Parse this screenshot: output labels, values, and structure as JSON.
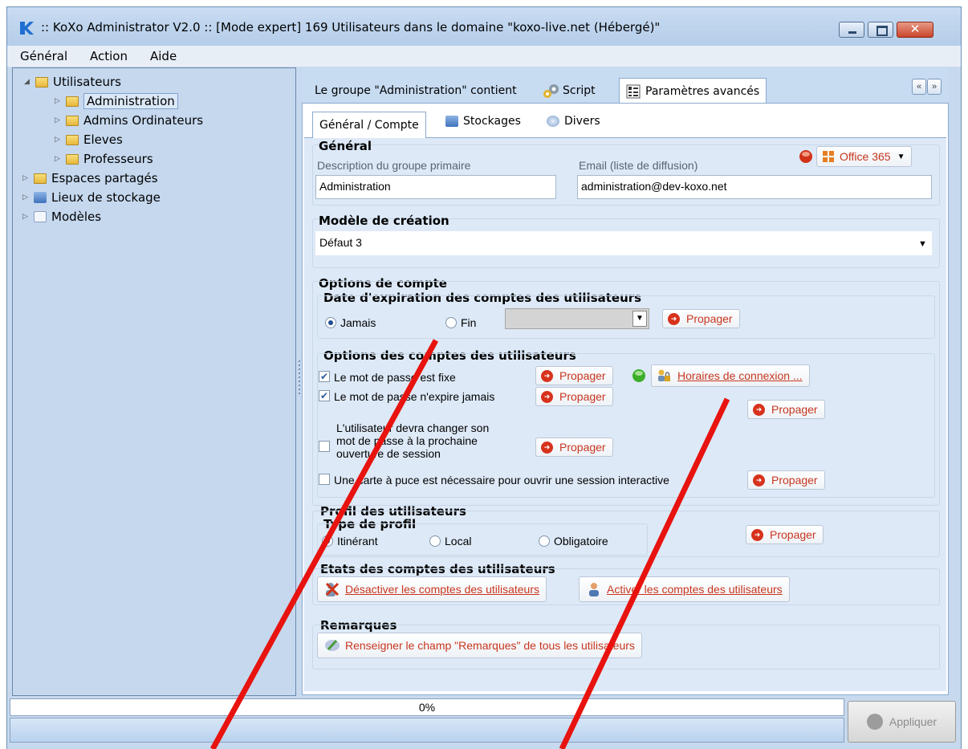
{
  "window": {
    "title": ":: KoXo Administrator V2.0 :: [Mode expert] 169 Utilisateurs dans le domaine \"koxo-live.net (Hébergé)\"",
    "close_glyph": "✕"
  },
  "menu": {
    "items": [
      "Général",
      "Action",
      "Aide"
    ]
  },
  "tree": {
    "items": [
      {
        "label": "Utilisateurs",
        "icon": "folder-icon"
      },
      {
        "label": "Administration",
        "icon": "folder-icon"
      },
      {
        "label": "Admins Ordinateurs",
        "icon": "folder-icon"
      },
      {
        "label": "Eleves",
        "icon": "folder-icon"
      },
      {
        "label": "Professeurs",
        "icon": "folder-icon"
      },
      {
        "label": "Espaces partagés",
        "icon": "shared-folder-icon"
      },
      {
        "label": "Lieux de stockage",
        "icon": "storage-icon"
      },
      {
        "label": "Modèles",
        "icon": "template-icon"
      }
    ]
  },
  "top_tabs": {
    "contains_label": "Le groupe \"Administration\" contient",
    "script": "Script",
    "advanced": "Paramètres avancés",
    "nav_prev": "«",
    "nav_next": "»"
  },
  "sub_tabs": {
    "general": "Général / Compte",
    "storage": "Stockages",
    "misc": "Divers"
  },
  "general": {
    "title": "Général",
    "desc_label": "Description du groupe primaire",
    "desc_value": "Administration",
    "email_label": "Email (liste de diffusion)",
    "email_value": "administration@dev-koxo.net",
    "office_label": "Office 365"
  },
  "model": {
    "title": "Modèle de création",
    "value": "Défaut 3"
  },
  "options": {
    "title": "Options de compte",
    "expiry_title": "Date d'expiration des comptes des utilisateurs",
    "never": "Jamais",
    "end": "Fin",
    "user_options_title": "Options des comptes des utilisateurs",
    "pw_fixed": "Le mot de passe est fixe",
    "pw_never_expires": "Le mot de passe n'expire jamais",
    "must_change_1": "L'utilisateur devra changer son",
    "must_change_2": "mot de passe à la prochaine",
    "must_change_3": "ouverture de session",
    "smartcard": "Une carte à puce est nécessaire pour ouvrir une session interactive",
    "logon_hours": "Horaires de connexion ...",
    "propagate": "Propager"
  },
  "profile": {
    "title": "Profil des utilisateurs",
    "type_title": "Type de profil",
    "roaming": "Itinérant",
    "local": "Local",
    "mandatory": "Obligatoire"
  },
  "states": {
    "title": "Etats des comptes des utilisateurs",
    "disable": "Désactiver les comptes des utilisateurs",
    "enable": "Activer les comptes des utilisateurs"
  },
  "remarks": {
    "title": "Remarques",
    "fill": "Renseigner le champ \"Remarques\" de tous les utilisateurs"
  },
  "status": {
    "progress_text": "0%",
    "progress": 0,
    "apply": "Appliquer"
  },
  "colors": {
    "accent_red": "#c8361f",
    "annotation": "#e8130f",
    "status_ok": "#3cae2a",
    "status_error": "#d23318"
  }
}
